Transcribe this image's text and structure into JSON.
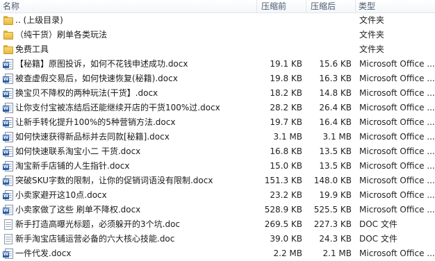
{
  "header": {
    "name": "名称",
    "compressed": "压缩前",
    "after": "压缩后",
    "type": "类型"
  },
  "rows": [
    {
      "icon": "folder-icon",
      "name": ".. (上级目录)",
      "size": "",
      "packed": "",
      "type": "文件夹"
    },
    {
      "icon": "folder-icon",
      "name": "（纯干货）刷单各类玩法",
      "size": "",
      "packed": "",
      "type": "文件夹"
    },
    {
      "icon": "folder-icon",
      "name": "免费工具",
      "size": "",
      "packed": "",
      "type": "文件夹"
    },
    {
      "icon": "word-doc-icon",
      "name": "【秘籍】原图投诉，如何不花钱申述成功.docx",
      "size": "19.1 KB",
      "packed": "15.6 KB",
      "type": "Microsoft Office ..."
    },
    {
      "icon": "word-doc-icon",
      "name": "被查虚假交易后，如何快速恢复(秘籍).docx",
      "size": "19.8 KB",
      "packed": "16.3 KB",
      "type": "Microsoft Office ..."
    },
    {
      "icon": "word-doc-icon",
      "name": "换宝贝不降权的两种玩法(干货】.docx",
      "size": "18.2 KB",
      "packed": "14.8 KB",
      "type": "Microsoft Office ..."
    },
    {
      "icon": "word-doc-icon",
      "name": "让你支付宝被冻结后还能继续开店的干货100%过.docx",
      "size": "28.2 KB",
      "packed": "26.4 KB",
      "type": "Microsoft Office ..."
    },
    {
      "icon": "word-doc-icon",
      "name": "让新手转化提升100%的5种营销方法.docx",
      "size": "19.7 KB",
      "packed": "16.4 KB",
      "type": "Microsoft Office ..."
    },
    {
      "icon": "word-doc-icon",
      "name": "如何快速获得新品标并去同款[秘籍].docx",
      "size": "3.1 MB",
      "packed": "3.1 MB",
      "type": "Microsoft Office ..."
    },
    {
      "icon": "word-doc-icon",
      "name": "如何快速联系淘宝小二  干货.docx",
      "size": "16.8 KB",
      "packed": "13.5 KB",
      "type": "Microsoft Office ..."
    },
    {
      "icon": "word-doc-icon",
      "name": "淘宝新手店铺的人生指针.docx",
      "size": "15.0 KB",
      "packed": "13.5 KB",
      "type": "Microsoft Office ..."
    },
    {
      "icon": "word-doc-icon",
      "name": "突破SKU字数的限制，让你的促销词语没有限制.docx",
      "size": "151.3 KB",
      "packed": "148.0 KB",
      "type": "Microsoft Office ..."
    },
    {
      "icon": "word-doc-icon",
      "name": "小卖家避开这10点.docx",
      "size": "23.2 KB",
      "packed": "19.9 KB",
      "type": "Microsoft Office ..."
    },
    {
      "icon": "word-doc-icon",
      "name": "小卖家做了这些 刷单不降权.docx",
      "size": "528.9 KB",
      "packed": "525.5 KB",
      "type": "Microsoft Office ..."
    },
    {
      "icon": "doc-file-icon",
      "name": "新手打造高曝光标题，必须躲开的3个坑.doc",
      "size": "269.5 KB",
      "packed": "227.3 KB",
      "type": "DOC 文件"
    },
    {
      "icon": "doc-file-icon",
      "name": "新手淘宝店铺运营必备的六大核心技能.doc",
      "size": "39.0 KB",
      "packed": "24.3 KB",
      "type": "DOC 文件"
    },
    {
      "icon": "word-doc-icon",
      "name": "一件代发.docx",
      "size": "2.2 MB",
      "packed": "2.1 MB",
      "type": "Microsoft Office ..."
    }
  ]
}
